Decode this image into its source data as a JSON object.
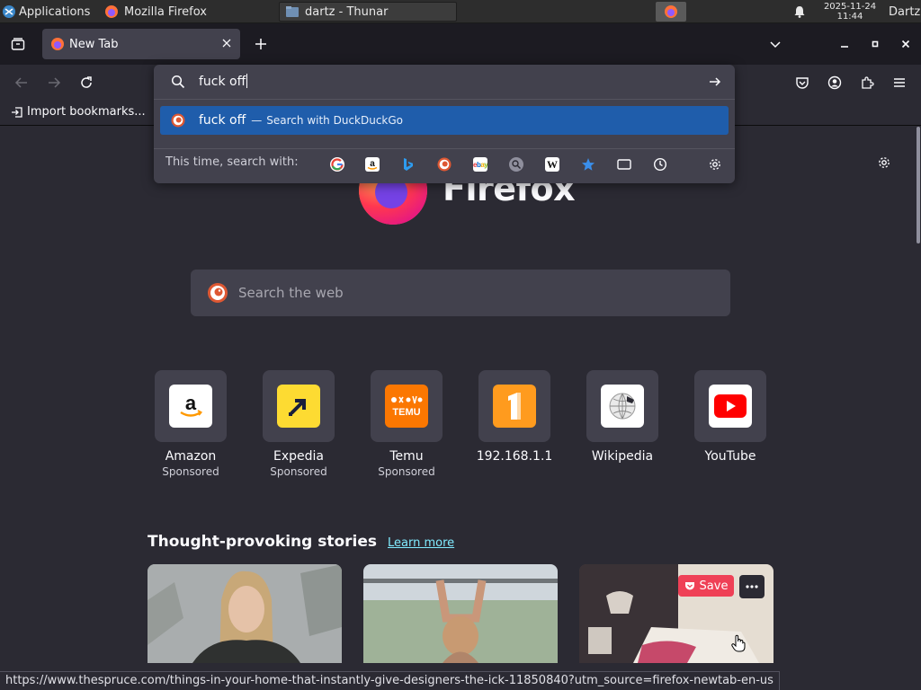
{
  "taskbar": {
    "apps_label": "Applications",
    "window1": "Mozilla Firefox",
    "window2": "dartz - Thunar",
    "clock_date": "2025-11-24",
    "clock_time": "11:44",
    "user": "Dartz"
  },
  "tab": {
    "title": "New Tab"
  },
  "urlbar": {
    "value": "fuck off",
    "suggestion_text": "fuck off",
    "suggestion_sep": "—",
    "suggestion_action": "Search with DuckDuckGo",
    "oneoff_label": "This time, search with:",
    "engines": [
      "Google",
      "Amazon",
      "Bing",
      "DuckDuckGo",
      "eBay",
      "Search",
      "Wikipedia",
      "Bookmarks",
      "Tabs",
      "History"
    ]
  },
  "bookmarks": {
    "import_label": "Import bookmarks..."
  },
  "newtab": {
    "brand": "Firefox",
    "search_placeholder": "Search the web",
    "tiles": [
      {
        "label": "Amazon",
        "sub": "Sponsored"
      },
      {
        "label": "Expedia",
        "sub": "Sponsored"
      },
      {
        "label": "Temu",
        "sub": "Sponsored"
      },
      {
        "label": "192.168.1.1",
        "sub": ""
      },
      {
        "label": "Wikipedia",
        "sub": ""
      },
      {
        "label": "YouTube",
        "sub": ""
      }
    ],
    "stories_heading": "Thought-provoking stories",
    "learn_more": "Learn more",
    "save_label": "Save",
    "temu_text": "TEMU"
  },
  "status_url": "https://www.thespruce.com/things-in-your-home-that-instantly-give-designers-the-ick-11850840?utm_source=firefox-newtab-en-us",
  "colors": {
    "accent": "#1f5dab",
    "link": "#80ebff",
    "pocket_red": "#ef4056"
  }
}
